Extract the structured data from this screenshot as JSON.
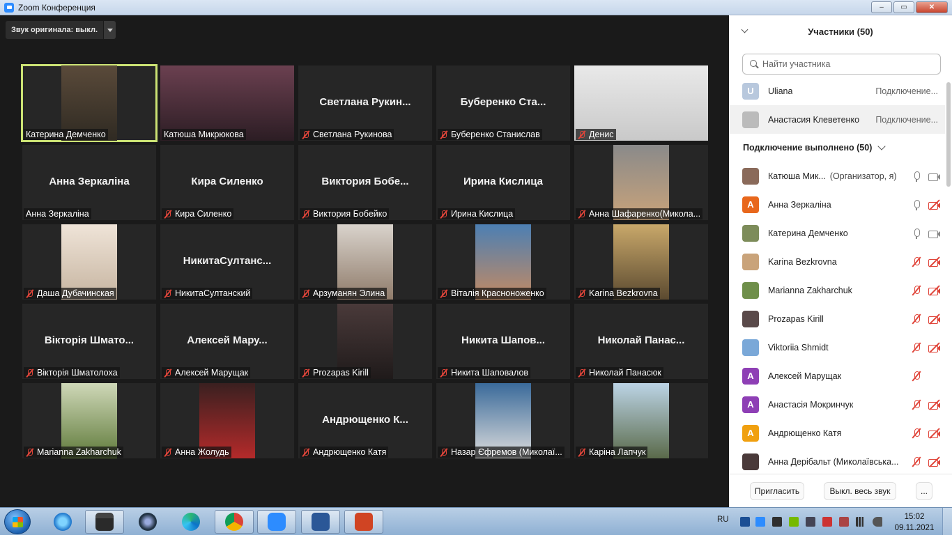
{
  "window": {
    "title": "Zoom Конференция"
  },
  "toolbar": {
    "original_sound_label": "Звук оригинала: выкл."
  },
  "tiles": [
    {
      "name": "Катерина Демченко",
      "big": "",
      "video": true,
      "muted": false,
      "active": true
    },
    {
      "name": "Катюша Микрюкова",
      "big": "",
      "video": true,
      "muted": false
    },
    {
      "name": "Светлана Рукинова",
      "big": "Светлана  Рукин...",
      "video": false,
      "muted": true
    },
    {
      "name": "Буберенко Станислав",
      "big": "Буберенко  Ста...",
      "video": false,
      "muted": true
    },
    {
      "name": "Денис",
      "big": "",
      "video": true,
      "muted": true
    },
    {
      "name": "Анна Зеркаліна",
      "big": "Анна Зеркаліна",
      "video": false,
      "muted": false
    },
    {
      "name": "Кира Силенко",
      "big": "Кира Силенко",
      "video": false,
      "muted": true
    },
    {
      "name": "Виктория Бобейко",
      "big": "Виктория  Бобе...",
      "video": false,
      "muted": true
    },
    {
      "name": "Ирина Кислица",
      "big": "Ирина Кислица",
      "video": false,
      "muted": true
    },
    {
      "name": "Анна Шафаренко(Микола...",
      "big": "",
      "video": true,
      "muted": true
    },
    {
      "name": "Даша Дубачинская",
      "big": "",
      "video": true,
      "muted": true
    },
    {
      "name": "НикитаСултанский",
      "big": "НикитаСултанс...",
      "video": false,
      "muted": true
    },
    {
      "name": "Арзуманян Элина",
      "big": "",
      "video": true,
      "muted": true
    },
    {
      "name": "Віталія Красноноженко",
      "big": "",
      "video": true,
      "muted": true
    },
    {
      "name": "Karina Bezkrovna",
      "big": "",
      "video": true,
      "muted": true
    },
    {
      "name": "Вікторія Шматолоха",
      "big": "Вікторія  Шмато...",
      "video": false,
      "muted": true
    },
    {
      "name": "Алексей Марущак",
      "big": "Алексей  Мару...",
      "video": false,
      "muted": true
    },
    {
      "name": "Prozapas Kirill",
      "big": "",
      "video": true,
      "muted": true
    },
    {
      "name": "Никита Шаповалов",
      "big": "Никита  Шапов...",
      "video": false,
      "muted": true
    },
    {
      "name": "Николай Панасюк",
      "big": "Николай  Панас...",
      "video": false,
      "muted": true
    },
    {
      "name": "Marianna Zakharchuk",
      "big": "",
      "video": true,
      "muted": true
    },
    {
      "name": "Анна Жолудь",
      "big": "",
      "video": true,
      "muted": true
    },
    {
      "name": "Андрющенко Катя",
      "big": "Андрющенко  К...",
      "video": false,
      "muted": true
    },
    {
      "name": "Назар Єфремов (Миколаї...",
      "big": "",
      "video": true,
      "muted": true
    },
    {
      "name": "Каріна Лапчук",
      "big": "",
      "video": true,
      "muted": true
    }
  ],
  "sidebar": {
    "title": "Участники (50)",
    "search_placeholder": "Найти участника",
    "waiting": [
      {
        "name": "Uliana",
        "status": "Подключение...",
        "avatar": "U"
      },
      {
        "name": "Анастасия Клеветенко",
        "status": "Подключение...",
        "avatar": ""
      }
    ],
    "section_label": "Подключение выполнено (50)",
    "participants": [
      {
        "name": "Катюша Мик...",
        "role": "(Организатор, я)",
        "mic": "on",
        "cam": "on",
        "avatar": "",
        "color": "#8a6a5a"
      },
      {
        "name": "Анна Зеркаліна",
        "role": "",
        "mic": "on",
        "cam": "off",
        "avatar": "А",
        "color": "#e8671c"
      },
      {
        "name": "Катерина Демченко",
        "role": "",
        "mic": "on",
        "cam": "on",
        "avatar": "",
        "color": "#7d8c5a"
      },
      {
        "name": "Karina Bezkrovna",
        "role": "",
        "mic": "off",
        "cam": "off",
        "avatar": "",
        "color": "#c9a37a"
      },
      {
        "name": "Marianna Zakharchuk",
        "role": "",
        "mic": "off",
        "cam": "off",
        "avatar": "",
        "color": "#6f8f4a"
      },
      {
        "name": "Prozapas Kirill",
        "role": "",
        "mic": "off",
        "cam": "off",
        "avatar": "",
        "color": "#5a4a4a"
      },
      {
        "name": "Viktoriia Shmidt",
        "role": "",
        "mic": "off",
        "cam": "off",
        "avatar": "",
        "color": "#7aa8d8"
      },
      {
        "name": "Алексей Марущак",
        "role": "",
        "mic": "off",
        "cam": "none",
        "avatar": "А",
        "color": "#8e3fb5"
      },
      {
        "name": "Анастасія Мокринчук",
        "role": "",
        "mic": "off",
        "cam": "off",
        "avatar": "А",
        "color": "#8e3fb5"
      },
      {
        "name": "Андрющенко Катя",
        "role": "",
        "mic": "off",
        "cam": "off",
        "avatar": "А",
        "color": "#f0a010"
      },
      {
        "name": "Анна Дерібальт (Миколаївська...",
        "role": "",
        "mic": "off",
        "cam": "off",
        "avatar": "",
        "color": "#4a3a3a"
      }
    ],
    "invite_label": "Пригласить",
    "mute_all_label": "Выкл. весь звук",
    "more_label": "..."
  },
  "taskbar": {
    "language": "RU",
    "time": "15:02",
    "date": "09.11.2021",
    "apps": [
      "start-button",
      "ie-icon",
      "explorer-icon",
      "media-player-icon",
      "edge-icon",
      "chrome-icon",
      "zoom-icon",
      "word-icon",
      "powerpoint-icon"
    ]
  }
}
